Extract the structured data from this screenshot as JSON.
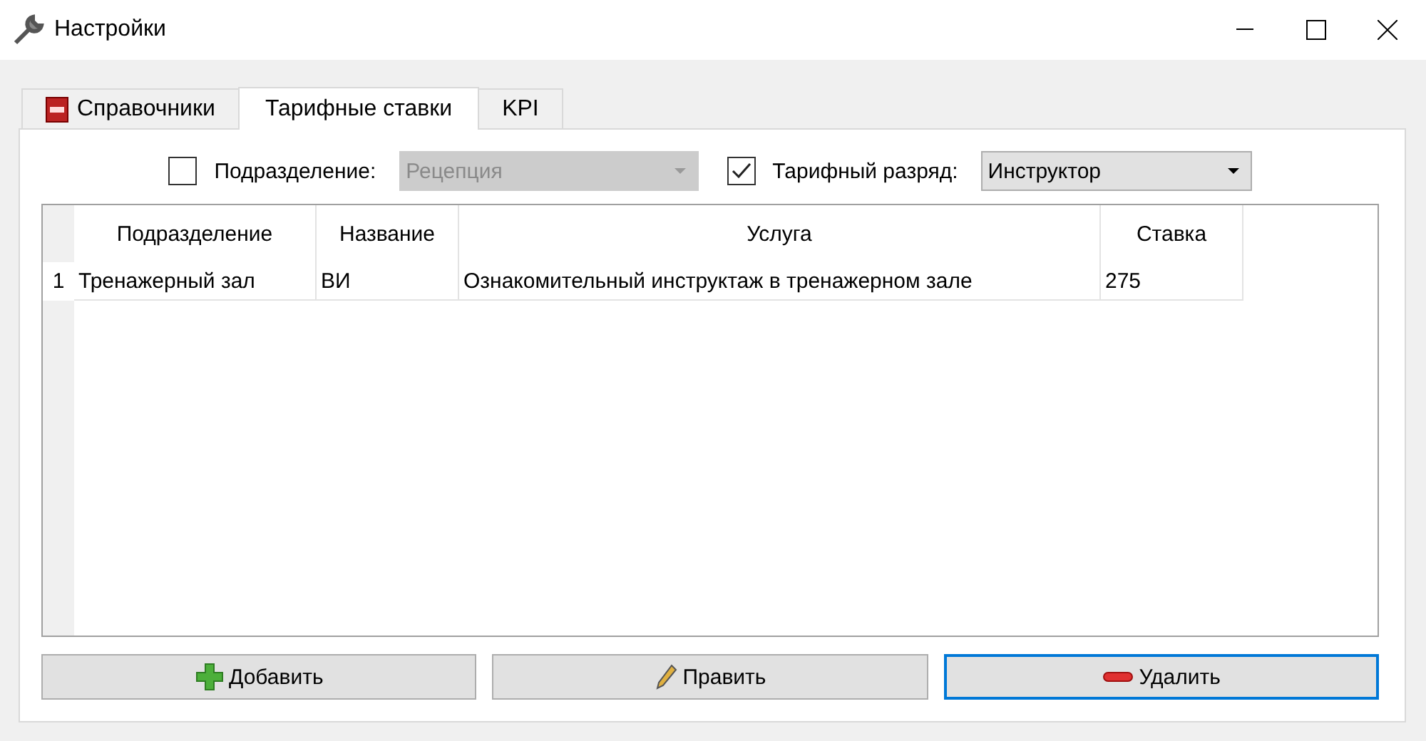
{
  "window": {
    "title": "Настройки"
  },
  "tabs": [
    {
      "label": "Справочники",
      "selected": false,
      "kind": "book"
    },
    {
      "label": "Тарифные ставки",
      "selected": true,
      "kind": "plain"
    },
    {
      "label": "KPI",
      "selected": false,
      "kind": "plain"
    }
  ],
  "filters": [
    {
      "label": "Подразделение:",
      "checked": false,
      "value": "Рецепция",
      "disabled": true
    },
    {
      "label": "Тарифный разряд:",
      "checked": true,
      "value": "Инструктор",
      "disabled": false
    }
  ],
  "table": {
    "columns": [
      "Подразделение",
      "Название",
      "Услуга",
      "Ставка"
    ],
    "rows": [
      {
        "number": "1",
        "cells": [
          "Тренажерный зал",
          "ВИ",
          "Ознакомительный инструктаж в тренажерном зале",
          "275"
        ]
      }
    ]
  },
  "buttons": [
    {
      "label": "Добавить",
      "kind": "add",
      "focused": false
    },
    {
      "label": "Править",
      "kind": "edit",
      "focused": false
    },
    {
      "label": "Удалить",
      "kind": "delete",
      "focused": true
    }
  ]
}
